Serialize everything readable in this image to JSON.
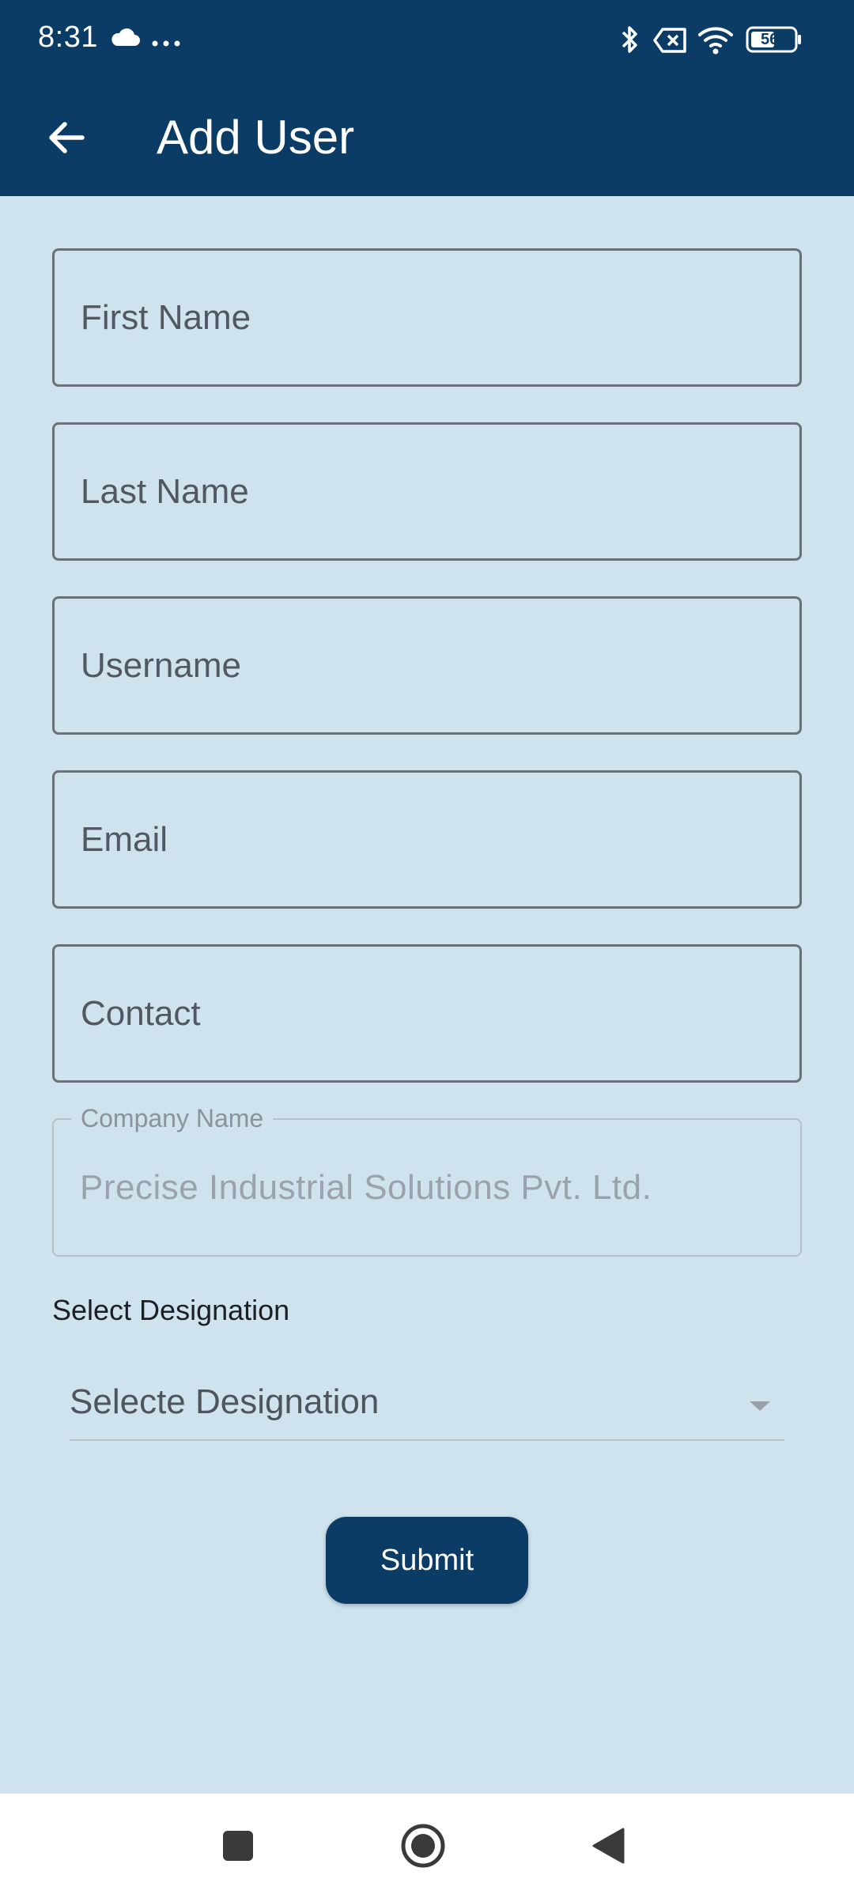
{
  "status_bar": {
    "time": "8:31",
    "battery": "56",
    "icons": [
      "cloud-icon",
      "more-dots-icon",
      "bluetooth-icon",
      "no-sim-icon",
      "wifi-icon",
      "battery-icon"
    ]
  },
  "app_bar": {
    "title": "Add User",
    "back_icon": "arrow-left-icon"
  },
  "form": {
    "first_name": {
      "placeholder": "First Name",
      "value": ""
    },
    "last_name": {
      "placeholder": "Last Name",
      "value": ""
    },
    "username": {
      "placeholder": "Username",
      "value": ""
    },
    "email": {
      "placeholder": "Email",
      "value": ""
    },
    "contact": {
      "placeholder": "Contact",
      "value": ""
    },
    "company_name": {
      "label": "Company Name",
      "value": "Precise Industrial Solutions Pvt. Ltd."
    },
    "designation": {
      "label": "Select Designation",
      "selected": "Selecte Designation"
    },
    "submit_label": "Submit"
  },
  "nav_bar": {
    "icons": [
      "recents-square-icon",
      "home-circle-icon",
      "back-triangle-icon"
    ]
  },
  "colors": {
    "primary": "#0a3c66",
    "background": "#cfe3ee",
    "nav_background": "#ffffff"
  }
}
